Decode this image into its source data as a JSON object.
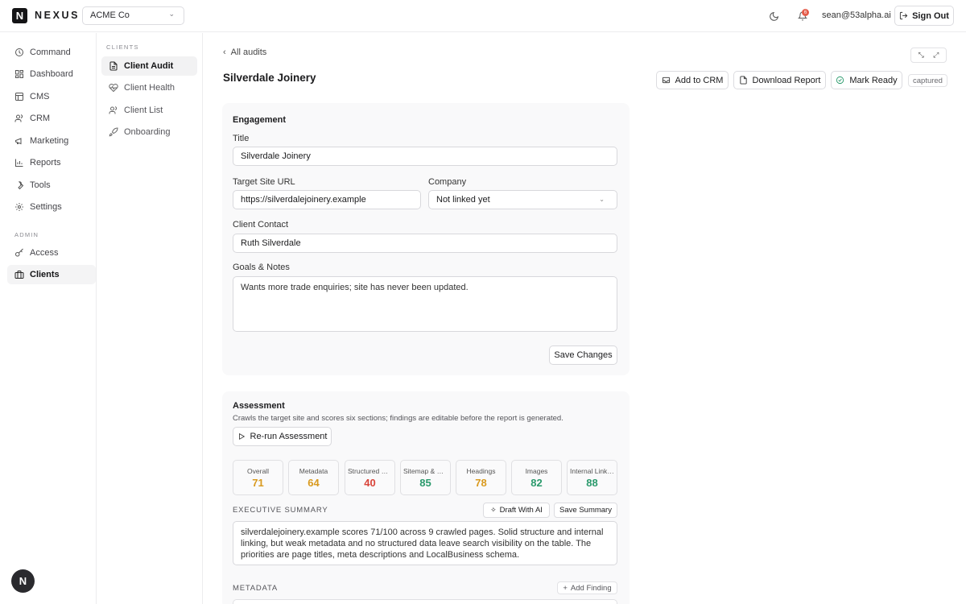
{
  "brand": {
    "logo_letter": "N",
    "name": "NEXUS"
  },
  "org_selector": {
    "value": "ACME Co"
  },
  "header": {
    "user_email": "sean@53alpha.ai",
    "notifications_count": "6",
    "sign_out_label": "Sign Out"
  },
  "sidebar": {
    "items": [
      {
        "label": "Command",
        "icon": "command-icon"
      },
      {
        "label": "Dashboard",
        "icon": "dashboard-icon"
      },
      {
        "label": "CMS",
        "icon": "cms-icon"
      },
      {
        "label": "CRM",
        "icon": "users-icon"
      },
      {
        "label": "Marketing",
        "icon": "megaphone-icon"
      },
      {
        "label": "Reports",
        "icon": "chart-icon"
      },
      {
        "label": "Tools",
        "icon": "wrench-icon"
      },
      {
        "label": "Settings",
        "icon": "gear-icon"
      }
    ],
    "admin_label": "ADMIN",
    "admin_items": [
      {
        "label": "Access",
        "icon": "key-icon"
      },
      {
        "label": "Clients",
        "icon": "briefcase-icon",
        "active": true
      }
    ],
    "avatar_letter": "N"
  },
  "subnav": {
    "section_label": "CLIENTS",
    "items": [
      {
        "label": "Client Audit",
        "icon": "file-icon",
        "active": true
      },
      {
        "label": "Client Health",
        "icon": "heart-pulse-icon"
      },
      {
        "label": "Client List",
        "icon": "users-icon"
      },
      {
        "label": "Onboarding",
        "icon": "rocket-icon"
      }
    ]
  },
  "page": {
    "back_label": "All audits",
    "title": "Silverdale Joinery",
    "actions": {
      "add_to_crm": "Add to CRM",
      "download_report": "Download Report",
      "mark_ready": "Mark Ready"
    },
    "status_badge": "captured"
  },
  "engagement": {
    "heading": "Engagement",
    "title_label": "Title",
    "title_value": "Silverdale Joinery",
    "url_label": "Target Site URL",
    "url_value": "https://silverdalejoinery.example",
    "company_label": "Company",
    "company_value": "Not linked yet",
    "contact_label": "Client Contact",
    "contact_value": "Ruth Silverdale",
    "notes_label": "Goals & Notes",
    "notes_value": "Wants more trade enquiries; site has never been updated.",
    "save_label": "Save Changes"
  },
  "assessment": {
    "heading": "Assessment",
    "description": "Crawls the target site and scores six sections; findings are editable before the report is generated.",
    "rerun_label": "Re-run Assessment",
    "scores": [
      {
        "label": "Overall",
        "value": "71",
        "color": "#d99a1e"
      },
      {
        "label": "Metadata",
        "value": "64",
        "color": "#d99a1e"
      },
      {
        "label": "Structured Data",
        "value": "40",
        "color": "#d9443a"
      },
      {
        "label": "Sitemap & Robots",
        "value": "85",
        "color": "#2a9a6c"
      },
      {
        "label": "Headings",
        "value": "78",
        "color": "#d99a1e"
      },
      {
        "label": "Images",
        "value": "82",
        "color": "#2a9a6c"
      },
      {
        "label": "Internal Linking",
        "value": "88",
        "color": "#2a9a6c"
      }
    ],
    "exec_summary_label": "EXECUTIVE SUMMARY",
    "draft_ai_label": "Draft With AI",
    "save_summary_label": "Save Summary",
    "exec_summary_text": "silverdalejoinery.example scores 71/100 across 9 crawled pages. Solid structure and internal linking, but weak metadata and no structured data leave search visibility on the table. The priorities are page titles, meta descriptions and LocalBusiness schema.",
    "metadata_label": "METADATA",
    "add_finding_label": "Add Finding"
  }
}
